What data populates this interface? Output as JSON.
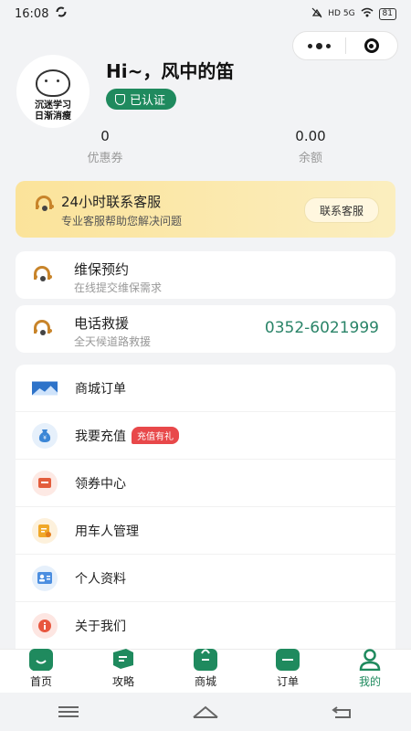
{
  "status_bar": {
    "time": "16:08",
    "battery": "81",
    "net_labels": "HD 5G"
  },
  "capsule": {
    "more_icon": "more-dots-icon",
    "close_icon": "target-icon"
  },
  "profile": {
    "avatar_text_line1": "沉迷学习",
    "avatar_text_line2": "日渐消瘦",
    "greeting": "Hi~，风中的笛",
    "verified_label": "已认证"
  },
  "stats": [
    {
      "value": "0",
      "label": "优惠券"
    },
    {
      "value": "0.00",
      "label": "余额"
    }
  ],
  "service_banner": {
    "title": "24小时联系客服",
    "subtitle": "专业客服帮助您解决问题",
    "button_label": "联系客服"
  },
  "cards": [
    {
      "title": "维保预约",
      "subtitle": "在线提交维保需求"
    },
    {
      "title": "电话救援",
      "subtitle": "全天候道路救援",
      "phone": "0352-6021999"
    }
  ],
  "menu": [
    {
      "label": "商城订单",
      "icon": "mall-order-icon"
    },
    {
      "label": "我要充值",
      "icon": "recharge-icon",
      "tag": "充值有礼"
    },
    {
      "label": "领券中心",
      "icon": "coupon-icon"
    },
    {
      "label": "用车人管理",
      "icon": "driver-management-icon"
    },
    {
      "label": "个人资料",
      "icon": "profile-icon"
    },
    {
      "label": "关于我们",
      "icon": "info-icon"
    }
  ],
  "tabbar": [
    {
      "label": "首页",
      "icon": "home-icon"
    },
    {
      "label": "攻略",
      "icon": "guide-icon"
    },
    {
      "label": "商城",
      "icon": "shop-icon"
    },
    {
      "label": "订单",
      "icon": "order-icon"
    },
    {
      "label": "我的",
      "icon": "user-icon",
      "active": true
    }
  ],
  "colors": {
    "primary": "#1f8a5e",
    "phone": "#2a8468",
    "tag": "#e8484a",
    "banner": "#fbe39a"
  }
}
